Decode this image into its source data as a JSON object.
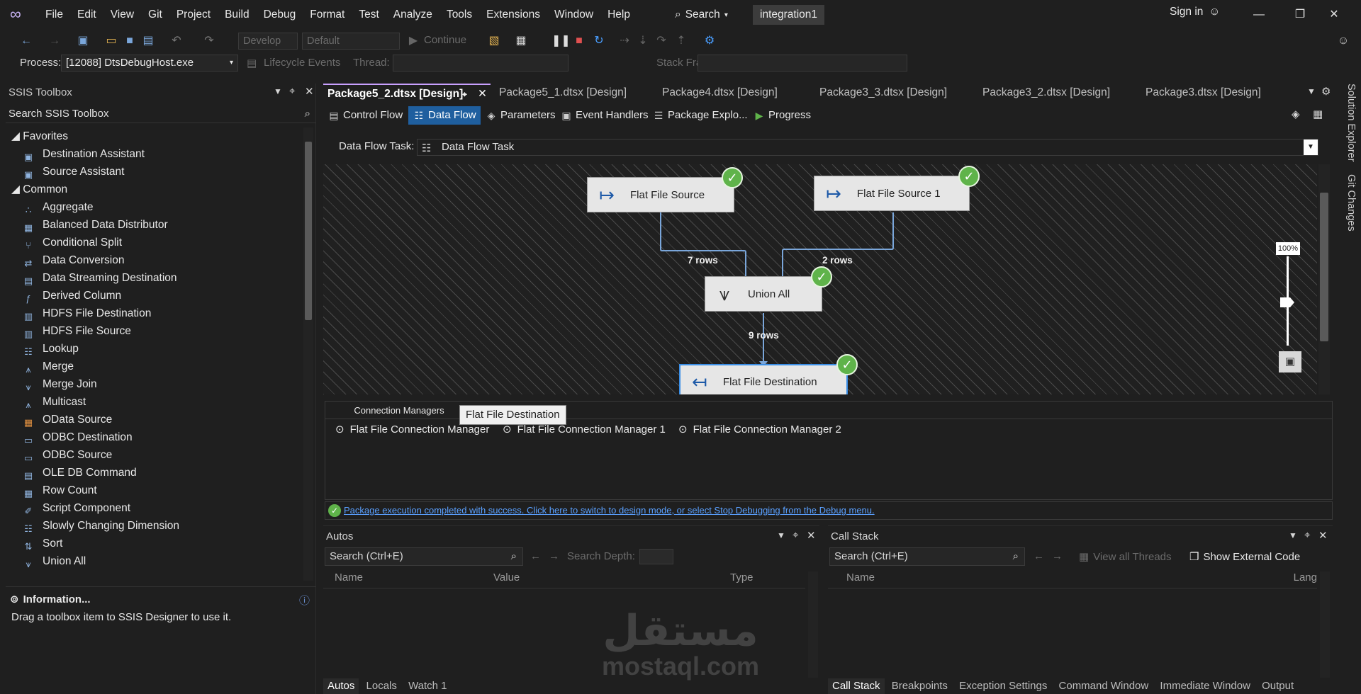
{
  "menubar": {
    "items": [
      "File",
      "Edit",
      "View",
      "Git",
      "Project",
      "Build",
      "Debug",
      "Format",
      "Test",
      "Analyze",
      "Tools",
      "Extensions",
      "Window",
      "Help"
    ],
    "search": "Search",
    "solution": "integration1",
    "signin": "Sign in"
  },
  "toolbar": {
    "config": "Develop",
    "platform": "Default",
    "continue": "Continue"
  },
  "debugbar": {
    "process_label": "Process:",
    "process_value": "[12088] DtsDebugHost.exe",
    "lifecycle": "Lifecycle Events",
    "thread_label": "Thread:",
    "stack_label": "Stack Frame:"
  },
  "toolbox": {
    "title": "SSIS Toolbox",
    "search": "Search SSIS Toolbox",
    "favorites_label": "Favorites",
    "favorites": [
      "Destination Assistant",
      "Source Assistant"
    ],
    "common_label": "Common",
    "common": [
      "Aggregate",
      "Balanced Data Distributor",
      "Conditional Split",
      "Data Conversion",
      "Data Streaming Destination",
      "Derived Column",
      "HDFS File Destination",
      "HDFS File Source",
      "Lookup",
      "Merge",
      "Merge Join",
      "Multicast",
      "OData Source",
      "ODBC Destination",
      "ODBC Source",
      "OLE DB Command",
      "Row Count",
      "Script Component",
      "Slowly Changing Dimension",
      "Sort",
      "Union All"
    ],
    "info_title": "Information...",
    "info_text": "Drag a toolbox item to SSIS Designer to use it."
  },
  "doctabs": [
    "Package5_2.dtsx [Design]",
    "Package5_1.dtsx [Design]",
    "Package4.dtsx [Design]",
    "Package3_3.dtsx [Design]",
    "Package3_2.dtsx [Design]",
    "Package3.dtsx [Design]"
  ],
  "designtabs": [
    "Control Flow",
    "Data Flow",
    "Parameters",
    "Event Handlers",
    "Package Explo...",
    "Progress"
  ],
  "dataflow": {
    "task_label": "Data Flow Task:",
    "task_value": "Data Flow Task",
    "zoom": "100%",
    "nodes": {
      "src1": "Flat File Source",
      "src2": "Flat File Source 1",
      "union": "Union All",
      "dest": "Flat File Destination"
    },
    "rows": {
      "a": "7 rows",
      "b": "2 rows",
      "c": "9 rows"
    }
  },
  "connmgr": {
    "tab": "Connection Managers",
    "tooltip": "Flat File Destination",
    "items": [
      "Flat File Connection Manager",
      "Flat File Connection Manager 1",
      "Flat File Connection Manager 2"
    ]
  },
  "status": {
    "message": "Package execution completed with success. Click here to switch to design mode, or select Stop Debugging from the Debug menu."
  },
  "autos": {
    "title": "Autos",
    "search": "Search (Ctrl+E)",
    "depth": "Search Depth:",
    "columns": [
      "Name",
      "Value",
      "Type"
    ],
    "tabs": [
      "Autos",
      "Locals",
      "Watch 1"
    ]
  },
  "callstack": {
    "title": "Call Stack",
    "search": "Search (Ctrl+E)",
    "view_threads": "View all Threads",
    "external": "Show External Code",
    "columns": [
      "Name",
      "Lang"
    ],
    "tabs": [
      "Call Stack",
      "Breakpoints",
      "Exception Settings",
      "Command Window",
      "Immediate Window",
      "Output"
    ]
  },
  "side": {
    "solution_explorer": "Solution Explorer",
    "git_changes": "Git Changes"
  },
  "watermark": {
    "arabic": "مستقل",
    "latin": "mostaql.com"
  }
}
